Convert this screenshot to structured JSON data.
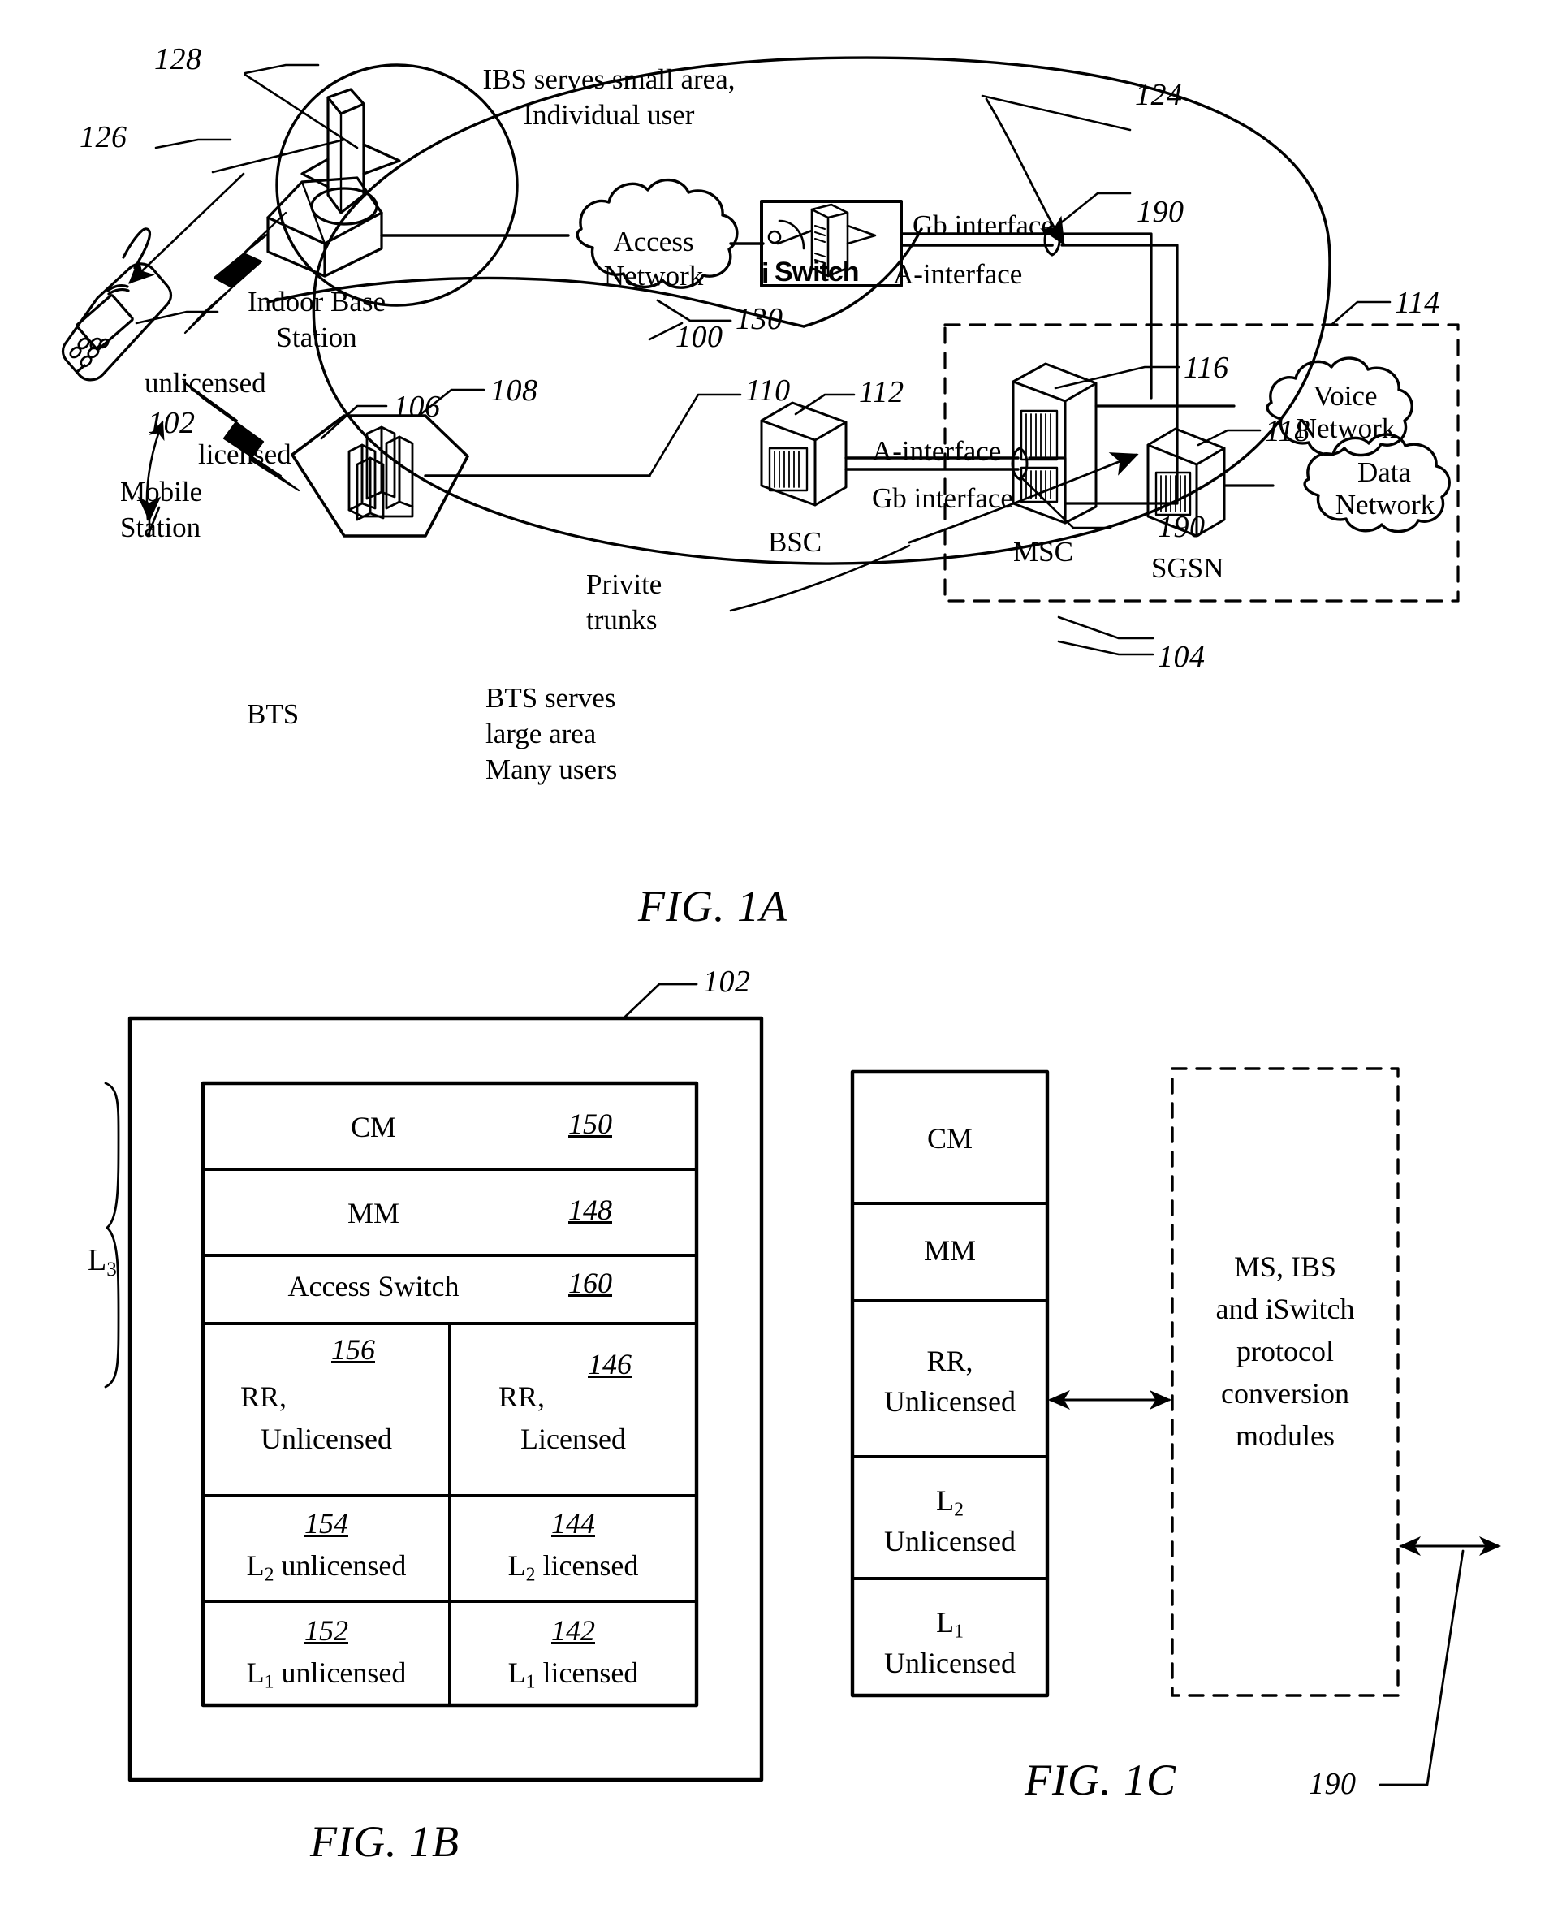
{
  "figures": [
    {
      "id": "fig1a",
      "caption": "FIG. 1A"
    },
    {
      "id": "fig1b",
      "caption": "FIG. 1B"
    },
    {
      "id": "fig1c",
      "caption": "FIG. 1C"
    }
  ],
  "fig1a": {
    "caption": "FIG. 1A",
    "annotations": {
      "ibs_note_line1": "IBS serves small area,",
      "ibs_note_line2": "Individual user",
      "indoor_base_station_line1": "Indoor Base",
      "indoor_base_station_line2": "Station",
      "access_network_line1": "Access",
      "access_network_line2": "Network",
      "iswitch_label": "Switch",
      "iswitch_prefix": "i",
      "gb_interface_top": "Gb interface",
      "a_interface_top": "A-interface",
      "unlicensed": "unlicensed",
      "licensed": "licensed",
      "mobile_station_line1": "Mobile",
      "mobile_station_line2": "Station",
      "bts": "BTS",
      "bts_note_line1": "BTS serves",
      "bts_note_line2": "large area",
      "bts_note_line3": "Many users",
      "private_trunks_line1": "Privite",
      "private_trunks_line2": "trunks",
      "bsc": "BSC",
      "a_interface_bottom": "A-interface",
      "gb_interface_bottom": "Gb interface",
      "msc": "MSC",
      "sgsn": "SGSN",
      "voice_network_line1": "Voice",
      "voice_network_line2": "Network",
      "data_network_line1": "Data",
      "data_network_line2": "Network"
    },
    "refs": {
      "r128": "128",
      "r126": "126",
      "r124": "124",
      "r190_top": "190",
      "r114": "114",
      "r116": "116",
      "r118": "118",
      "r130": "130",
      "r102": "102",
      "r100": "100",
      "r106": "106",
      "r108": "108",
      "r110": "110",
      "r112": "112",
      "r190_bottom": "190",
      "r104": "104"
    }
  },
  "fig1b": {
    "caption": "FIG. 1B",
    "outer_ref": "102",
    "bracket_label": "L",
    "bracket_sub": "3",
    "rows": [
      {
        "type": "full",
        "label": "CM",
        "ref": "150"
      },
      {
        "type": "full",
        "label": "MM",
        "ref": "148"
      },
      {
        "type": "full",
        "label": "Access Switch",
        "ref": "160"
      },
      {
        "type": "split",
        "left": {
          "label_line1": "RR,",
          "label_line2": "Unlicensed",
          "ref": "156"
        },
        "right": {
          "label_line1": "RR,",
          "label_line2": "Licensed",
          "ref": "146"
        }
      },
      {
        "type": "split",
        "left": {
          "label_main": "L",
          "label_sub": "2",
          "label_tail": " unlicensed",
          "ref": "154"
        },
        "right": {
          "label_main": "L",
          "label_sub": "2",
          "label_tail": " licensed",
          "ref": "144"
        }
      },
      {
        "type": "split",
        "left": {
          "label_main": "L",
          "label_sub": "1",
          "label_tail": " unlicensed",
          "ref": "152"
        },
        "right": {
          "label_main": "L",
          "label_sub": "1",
          "label_tail": " licensed",
          "ref": "142"
        }
      }
    ]
  },
  "fig1c": {
    "caption": "FIG. 1C",
    "ref_190": "190",
    "stack": [
      {
        "line1": "CM"
      },
      {
        "line1": "MM"
      },
      {
        "line1": "RR,",
        "line2": "Unlicensed"
      },
      {
        "line1": "L",
        "sub": "2",
        "line2": "Unlicensed"
      },
      {
        "line1": "L",
        "sub": "1",
        "line2": "Unlicensed"
      }
    ],
    "conversion_box": {
      "line1": "MS, IBS",
      "line2": "and iSwitch",
      "line3": "protocol",
      "line4": "conversion",
      "line5": "modules"
    }
  },
  "colors": {
    "ink": "#000000",
    "paper": "#ffffff"
  }
}
